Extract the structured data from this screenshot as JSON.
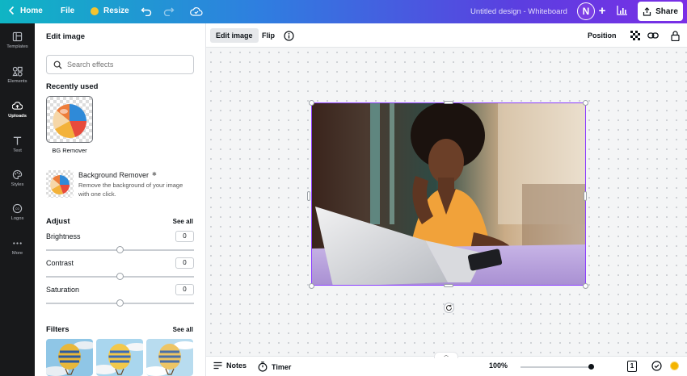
{
  "topbar": {
    "home_label": "Home",
    "file_label": "File",
    "resize_label": "Resize",
    "doc_title": "Untitled design - Whiteboard",
    "avatar_letter": "N",
    "share_label": "Share",
    "colors": {
      "gradient_start": "#0fb5c4",
      "gradient_end": "#7a2ee6"
    }
  },
  "rail": {
    "items": [
      {
        "label": "Templates",
        "icon": "templates-icon"
      },
      {
        "label": "Elements",
        "icon": "elements-icon"
      },
      {
        "label": "Uploads",
        "icon": "uploads-icon",
        "active": true
      },
      {
        "label": "Text",
        "icon": "text-icon"
      },
      {
        "label": "Styles",
        "icon": "styles-icon"
      },
      {
        "label": "Logos",
        "icon": "logos-icon"
      },
      {
        "label": "More",
        "icon": "more-icon"
      }
    ]
  },
  "panel": {
    "title": "Edit image",
    "search_placeholder": "Search effects",
    "recently_used_title": "Recently used",
    "recent_item_label": "BG Remover",
    "app": {
      "name": "Background Remover",
      "description": "Remove the background of your image with one click."
    },
    "adjust": {
      "title": "Adjust",
      "see_all": "See all",
      "controls": [
        {
          "label": "Brightness",
          "value": "0",
          "level": 0.5
        },
        {
          "label": "Contrast",
          "value": "0",
          "level": 0.5
        },
        {
          "label": "Saturation",
          "value": "0",
          "level": 0.5
        }
      ]
    },
    "filters": {
      "title": "Filters",
      "see_all": "See all"
    }
  },
  "context_bar": {
    "edit_image_label": "Edit image",
    "flip_label": "Flip",
    "position_label": "Position"
  },
  "bottom_bar": {
    "notes_label": "Notes",
    "timer_label": "Timer",
    "zoom_value": "100%",
    "page_count": "1"
  },
  "selection_color": "#8b3dff"
}
